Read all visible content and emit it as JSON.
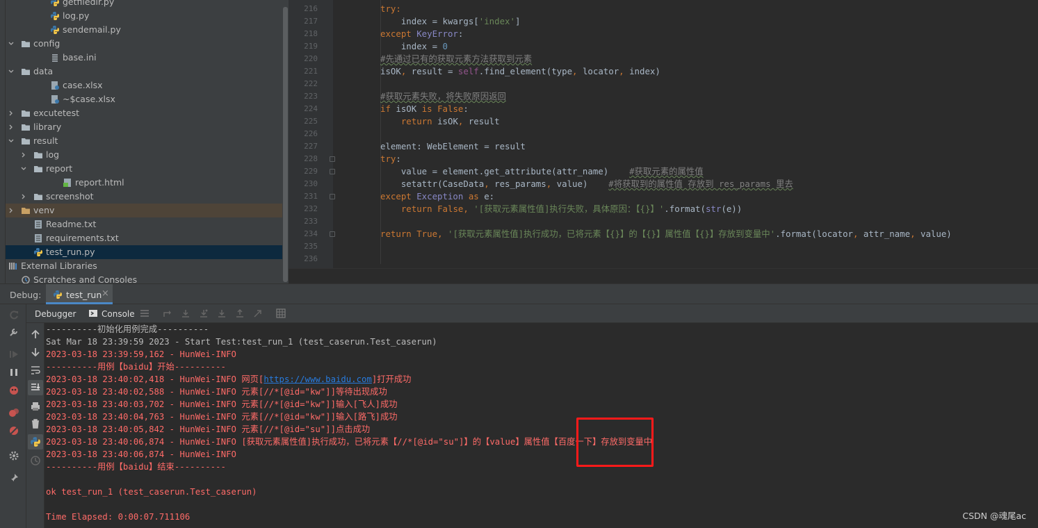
{
  "project_tree": [
    {
      "label": "getfiledir.py",
      "type": "py",
      "partial": true
    },
    {
      "label": "log.py",
      "type": "py"
    },
    {
      "label": "sendemail.py",
      "type": "py"
    },
    {
      "label": "config",
      "type": "folder",
      "expanded": true
    },
    {
      "label": "base.ini",
      "type": "ini"
    },
    {
      "label": "data",
      "type": "folder",
      "expanded": true
    },
    {
      "label": "case.xlsx",
      "type": "xlsx"
    },
    {
      "label": "~$case.xlsx",
      "type": "xlsx"
    },
    {
      "label": "excutetest",
      "type": "folder",
      "expanded": false
    },
    {
      "label": "library",
      "type": "folder",
      "expanded": false
    },
    {
      "label": "result",
      "type": "folder",
      "expanded": true
    },
    {
      "label": "log",
      "type": "folder",
      "expanded": false
    },
    {
      "label": "report",
      "type": "folder",
      "expanded": true
    },
    {
      "label": "report.html",
      "type": "html"
    },
    {
      "label": "screenshot",
      "type": "folder",
      "expanded": false
    },
    {
      "label": "venv",
      "type": "folder-venv",
      "expanded": false
    },
    {
      "label": "Readme.txt",
      "type": "txt"
    },
    {
      "label": "requirements.txt",
      "type": "txt"
    },
    {
      "label": "test_run.py",
      "type": "py",
      "selected": true
    },
    {
      "label": "External Libraries",
      "type": "libs",
      "expanded": false
    },
    {
      "label": "Scratches and Consoles",
      "type": "scratch"
    }
  ],
  "editor": {
    "line_numbers": [
      "216",
      "217",
      "218",
      "219",
      "220",
      "221",
      "222",
      "223",
      "224",
      "225",
      "226",
      "227",
      "228",
      "229",
      "230",
      "231",
      "232",
      "233",
      "234",
      "235",
      "236"
    ],
    "lines": [
      [
        {
          "t": "try",
          "c": "kw"
        },
        {
          "t": ":",
          "c": "kw"
        }
      ],
      [
        {
          "t": "    index = kwargs[",
          "c": ""
        },
        {
          "t": "'index'",
          "c": "str"
        },
        {
          "t": "]",
          "c": ""
        }
      ],
      [
        {
          "t": "except ",
          "c": "kw"
        },
        {
          "t": "KeyError",
          "c": "cls"
        },
        {
          "t": ":",
          "c": ""
        }
      ],
      [
        {
          "t": "    index = ",
          "c": ""
        },
        {
          "t": "0",
          "c": "num"
        }
      ],
      [
        {
          "t": "#先通过已有的获取元素方法获取到元素",
          "c": "cmt sq"
        }
      ],
      [
        {
          "t": "isOK",
          "c": ""
        },
        {
          "t": ", ",
          "c": "kw"
        },
        {
          "t": "result = ",
          "c": ""
        },
        {
          "t": "self",
          "c": "self"
        },
        {
          "t": ".find_element(",
          "c": ""
        },
        {
          "t": "type",
          "c": ""
        },
        {
          "t": ", ",
          "c": "kw"
        },
        {
          "t": "locator",
          "c": ""
        },
        {
          "t": ", ",
          "c": "kw"
        },
        {
          "t": "index)",
          "c": ""
        }
      ],
      [],
      [
        {
          "t": "#获取元素失败，将失败原因返回",
          "c": "cmt sq"
        }
      ],
      [
        {
          "t": "if ",
          "c": "kw"
        },
        {
          "t": "isOK ",
          "c": ""
        },
        {
          "t": "is ",
          "c": "kw"
        },
        {
          "t": "False",
          "c": "kw"
        },
        {
          "t": ":",
          "c": ""
        }
      ],
      [
        {
          "t": "    return ",
          "c": "kw"
        },
        {
          "t": "isOK",
          "c": ""
        },
        {
          "t": ", ",
          "c": "kw"
        },
        {
          "t": "result",
          "c": ""
        }
      ],
      [],
      [
        {
          "t": "element: WebElement = result",
          "c": ""
        }
      ],
      [
        {
          "t": "try",
          "c": "kw"
        },
        {
          "t": ":",
          "c": ""
        }
      ],
      [
        {
          "t": "    value = element.get_attribute(attr_name)    ",
          "c": ""
        },
        {
          "t": "#获取元素的属性值",
          "c": "cmt sq"
        }
      ],
      [
        {
          "t": "    setattr",
          "c": ""
        },
        {
          "t": "(CaseData",
          "c": ""
        },
        {
          "t": ", ",
          "c": "kw"
        },
        {
          "t": "res_params",
          "c": ""
        },
        {
          "t": ", ",
          "c": "kw"
        },
        {
          "t": "value)    ",
          "c": ""
        },
        {
          "t": "#将获取到的属性值 存放到 res_params 里去",
          "c": "cmt sq"
        }
      ],
      [
        {
          "t": "except ",
          "c": "kw"
        },
        {
          "t": "Exception ",
          "c": "cls"
        },
        {
          "t": "as ",
          "c": "kw"
        },
        {
          "t": "e:",
          "c": ""
        }
      ],
      [
        {
          "t": "    return ",
          "c": "kw"
        },
        {
          "t": "False",
          "c": "kw"
        },
        {
          "t": ", ",
          "c": "kw"
        },
        {
          "t": "'[获取元素属性值]执行失败，具体原因：【{}】'",
          "c": "str"
        },
        {
          "t": ".format(",
          "c": ""
        },
        {
          "t": "str",
          "c": "cls"
        },
        {
          "t": "(e))",
          "c": ""
        }
      ],
      [],
      [
        {
          "t": "return ",
          "c": "kw"
        },
        {
          "t": "True",
          "c": "kw"
        },
        {
          "t": ", ",
          "c": "kw"
        },
        {
          "t": "'[获取元素属性值]执行成功，已将元素【{}】的【{}】属性值【{}】存放到变量中'",
          "c": "str"
        },
        {
          "t": ".format(locator",
          "c": ""
        },
        {
          "t": ", ",
          "c": "kw"
        },
        {
          "t": "attr_name",
          "c": ""
        },
        {
          "t": ", ",
          "c": "kw"
        },
        {
          "t": "value)",
          "c": ""
        }
      ],
      [],
      []
    ]
  },
  "debug_panel": {
    "title": "Debug:",
    "tab_label": "test_run",
    "subtabs": [
      "Debugger",
      "Console"
    ]
  },
  "console_lines": [
    {
      "text": "----------初始化用例完成----------",
      "color": "w"
    },
    {
      "text": "Sat Mar 18 23:39:59 2023 - Start Test:test_run_1 (test_caserun.Test_caserun)",
      "color": "w"
    },
    {
      "text": "2023-03-18 23:39:59,162 - HunWei-INFO",
      "color": "r"
    },
    {
      "text": "----------用例【baidu】开始----------",
      "color": "r"
    },
    {
      "text": "2023-03-18 23:40:02,418 - HunWei-INFO 网页[",
      "color": "r",
      "url": "https://www.baidu.com",
      "after": "]打开成功"
    },
    {
      "text": "2023-03-18 23:40:02,588 - HunWei-INFO 元素[//*[@id=\"kw\"]]等待出现成功",
      "color": "r"
    },
    {
      "text": "2023-03-18 23:40:03,702 - HunWei-INFO 元素[//*[@id=\"kw\"]]输入[飞人]成功",
      "color": "r"
    },
    {
      "text": "2023-03-18 23:40:04,763 - HunWei-INFO 元素[//*[@id=\"kw\"]]输入[路飞]成功",
      "color": "r"
    },
    {
      "text": "2023-03-18 23:40:05,842 - HunWei-INFO 元素[//*[@id=\"su\"]]点击成功",
      "color": "r"
    },
    {
      "text": "2023-03-18 23:40:06,874 - HunWei-INFO [获取元素属性值]执行成功，已将元素【//*[@id=\"su\"]】的【value】属性值【百度一下】存放到变量中",
      "color": "r"
    },
    {
      "text": "2023-03-18 23:40:06,874 - HunWei-INFO",
      "color": "r"
    },
    {
      "text": "----------用例【baidu】结束----------",
      "color": "r"
    },
    {
      "text": "",
      "color": "w"
    },
    {
      "text": "ok test_run_1 (test_caserun.Test_caserun)",
      "color": "r"
    },
    {
      "text": "",
      "color": "w"
    },
    {
      "text": "Time Elapsed: 0:00:07.711106",
      "color": "r"
    }
  ],
  "watermark": "CSDN @魂尾ac"
}
